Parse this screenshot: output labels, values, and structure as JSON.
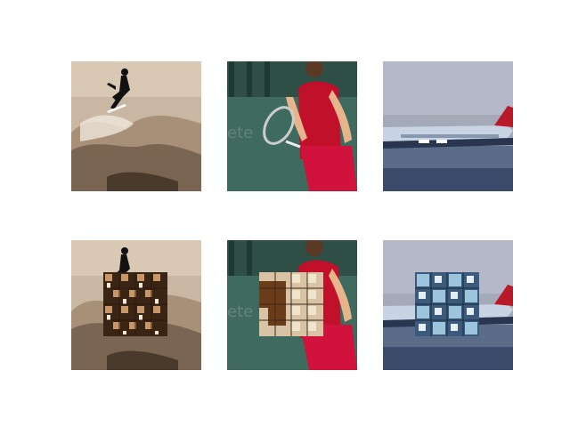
{
  "figure": {
    "rows": [
      {
        "row": "original",
        "panels": [
          {
            "subject": "surfer",
            "palette": [
              "#c8b4a0",
              "#8c7864",
              "#efe6dc"
            ]
          },
          {
            "subject": "tennis-player",
            "palette": [
              "#3f6b5e",
              "#c0102a",
              "#e8b48c"
            ]
          },
          {
            "subject": "airplane",
            "palette": [
              "#a4aab8",
              "#3c4a6c",
              "#c8d4e4"
            ]
          }
        ]
      },
      {
        "row": "with-patch",
        "panels": [
          {
            "subject": "surfer",
            "patch_palette": [
              "#5a3a24",
              "#c89668",
              "#f4e8d8",
              "#2a1a10"
            ]
          },
          {
            "subject": "tennis-player",
            "patch_palette": [
              "#6a3c1a",
              "#d8b48c",
              "#f0e4cc",
              "#3a2a1a"
            ]
          },
          {
            "subject": "airplane",
            "patch_palette": [
              "#3c5a7c",
              "#9cc4dc",
              "#e4eef4",
              "#1a2a3c"
            ]
          }
        ]
      }
    ]
  }
}
